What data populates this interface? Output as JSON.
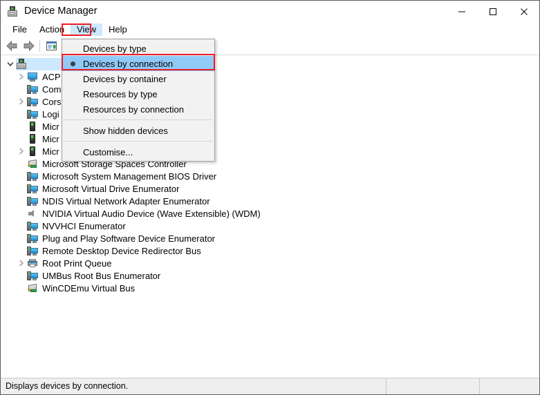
{
  "window": {
    "title": "Device Manager",
    "icon": "device-manager-icon",
    "controls": {
      "minimize": "minimize-icon",
      "maximize": "maximize-icon",
      "close": "close-icon"
    }
  },
  "menubar": {
    "items": [
      {
        "label": "File",
        "open": false
      },
      {
        "label": "Action",
        "open": false
      },
      {
        "label": "View",
        "open": true
      },
      {
        "label": "Help",
        "open": false
      }
    ],
    "highlight_color": "#ed1c24",
    "open_background": "#cde8ff"
  },
  "toolbar": {
    "buttons": [
      {
        "name": "back-button",
        "icon": "arrow-left-icon",
        "enabled": true
      },
      {
        "name": "forward-button",
        "icon": "arrow-right-icon",
        "enabled": true
      },
      {
        "name": "properties-button",
        "icon": "properties-icon",
        "enabled": true
      }
    ]
  },
  "view_menu": {
    "items": [
      {
        "label": "Devices by type",
        "checked": false,
        "separator_after": false
      },
      {
        "label": "Devices by connection",
        "checked": true,
        "separator_after": false
      },
      {
        "label": "Devices by container",
        "checked": false,
        "separator_after": false
      },
      {
        "label": "Resources by type",
        "checked": false,
        "separator_after": false
      },
      {
        "label": "Resources by connection",
        "checked": false,
        "separator_after": true
      },
      {
        "label": "Show hidden devices",
        "checked": false,
        "separator_after": true
      },
      {
        "label": "Customise...",
        "checked": false,
        "separator_after": false
      }
    ],
    "selected_background": "#91c9f7",
    "annotation_color": "#ed1c24",
    "radio_bullet_color": "#3f3f3f"
  },
  "tree": {
    "selection_background": "#cce8ff",
    "rows": [
      {
        "label": "",
        "depth": 0,
        "icon": "root-device-icon",
        "expanded": true,
        "has_children": true,
        "selected": true,
        "obscured": false
      },
      {
        "label": "ACP",
        "depth": 1,
        "icon": "monitor-icon",
        "expanded": false,
        "has_children": true,
        "selected": false,
        "obscured": true
      },
      {
        "label": "Com",
        "depth": 1,
        "icon": "computer-icon",
        "expanded": false,
        "has_children": false,
        "selected": false,
        "obscured": true
      },
      {
        "label": "Cors",
        "depth": 1,
        "icon": "computer-icon",
        "expanded": false,
        "has_children": true,
        "selected": false,
        "obscured": true
      },
      {
        "label": "Logi",
        "depth": 1,
        "icon": "computer-icon",
        "expanded": false,
        "has_children": false,
        "selected": false,
        "obscured": true
      },
      {
        "label": "Micr",
        "depth": 1,
        "icon": "device-icon",
        "expanded": false,
        "has_children": false,
        "selected": false,
        "obscured": true
      },
      {
        "label": "Micr",
        "depth": 1,
        "icon": "device-icon",
        "expanded": false,
        "has_children": false,
        "selected": false,
        "obscured": true
      },
      {
        "label": "Micr",
        "depth": 1,
        "icon": "device-icon",
        "expanded": false,
        "has_children": true,
        "selected": false,
        "obscured": true
      },
      {
        "label": "Microsoft Storage Spaces Controller",
        "depth": 1,
        "icon": "storage-controller-icon",
        "expanded": false,
        "has_children": false,
        "selected": false,
        "obscured": false
      },
      {
        "label": "Microsoft System Management BIOS Driver",
        "depth": 1,
        "icon": "computer-icon",
        "expanded": false,
        "has_children": false,
        "selected": false,
        "obscured": false
      },
      {
        "label": "Microsoft Virtual Drive Enumerator",
        "depth": 1,
        "icon": "computer-icon",
        "expanded": false,
        "has_children": false,
        "selected": false,
        "obscured": false
      },
      {
        "label": "NDIS Virtual Network Adapter Enumerator",
        "depth": 1,
        "icon": "computer-icon",
        "expanded": false,
        "has_children": false,
        "selected": false,
        "obscured": false
      },
      {
        "label": "NVIDIA Virtual Audio Device (Wave Extensible) (WDM)",
        "depth": 1,
        "icon": "speaker-icon",
        "expanded": false,
        "has_children": false,
        "selected": false,
        "obscured": false
      },
      {
        "label": "NVVHCI Enumerator",
        "depth": 1,
        "icon": "computer-icon",
        "expanded": false,
        "has_children": false,
        "selected": false,
        "obscured": false
      },
      {
        "label": "Plug and Play Software Device Enumerator",
        "depth": 1,
        "icon": "computer-icon",
        "expanded": false,
        "has_children": false,
        "selected": false,
        "obscured": false
      },
      {
        "label": "Remote Desktop Device Redirector Bus",
        "depth": 1,
        "icon": "computer-icon",
        "expanded": false,
        "has_children": false,
        "selected": false,
        "obscured": false
      },
      {
        "label": "Root Print Queue",
        "depth": 1,
        "icon": "printer-icon",
        "expanded": false,
        "has_children": true,
        "selected": false,
        "obscured": false
      },
      {
        "label": "UMBus Root Bus Enumerator",
        "depth": 1,
        "icon": "computer-icon",
        "expanded": false,
        "has_children": false,
        "selected": false,
        "obscured": false
      },
      {
        "label": "WinCDEmu Virtual Bus",
        "depth": 1,
        "icon": "storage-controller-icon",
        "expanded": false,
        "has_children": false,
        "selected": false,
        "obscured": false
      }
    ]
  },
  "statusbar": {
    "message": "Displays devices by connection.",
    "pane_2": "",
    "pane_3": ""
  }
}
